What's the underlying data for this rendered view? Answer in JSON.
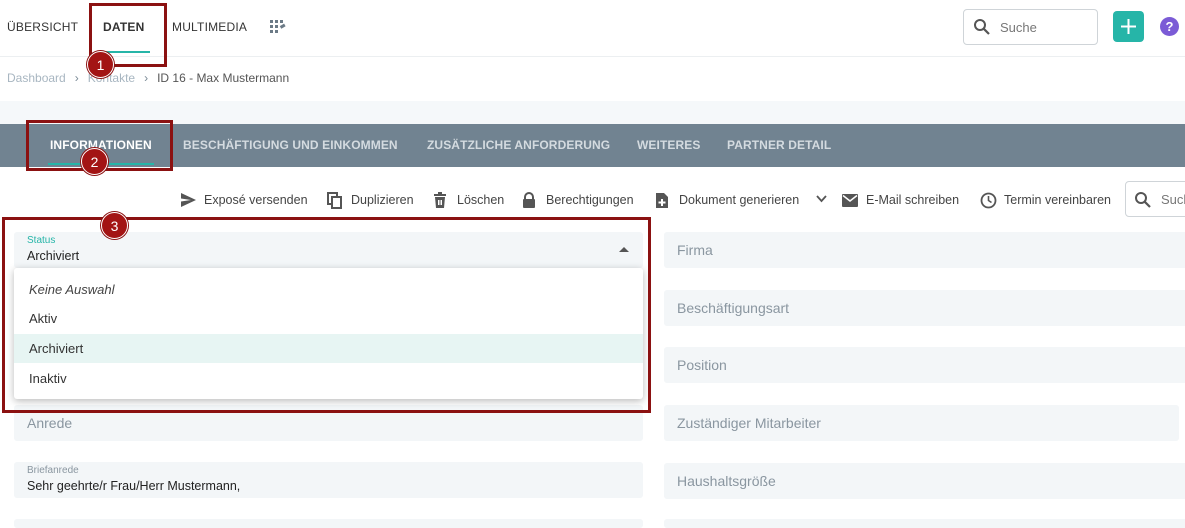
{
  "topnav": {
    "tabs": [
      {
        "label": "ÜBERSICHT"
      },
      {
        "label": "DATEN"
      },
      {
        "label": "MULTIMEDIA"
      }
    ],
    "search_placeholder": "Suche",
    "help_label": "?"
  },
  "breadcrumb": {
    "items": [
      "Dashboard",
      "Kontakte",
      "ID 16 - Max Mustermann"
    ],
    "separator": "›"
  },
  "section_tabs": [
    {
      "label": "INFORMATIONEN"
    },
    {
      "label": "BESCHÄFTIGUNG UND EINKOMMEN"
    },
    {
      "label": "ZUSÄTZLICHE ANFORDERUNG"
    },
    {
      "label": "WEITERES"
    },
    {
      "label": "PARTNER DETAIL"
    }
  ],
  "toolbar": {
    "actions": [
      {
        "label": "Exposé versenden",
        "icon": "send-icon"
      },
      {
        "label": "Duplizieren",
        "icon": "copy-icon"
      },
      {
        "label": "Löschen",
        "icon": "trash-icon"
      },
      {
        "label": "Berechtigungen",
        "icon": "lock-icon"
      },
      {
        "label": "Dokument generieren",
        "icon": "document-plus-icon"
      },
      {
        "label": "E-Mail schreiben",
        "icon": "mail-icon"
      },
      {
        "label": "Termin vereinbaren",
        "icon": "clock-icon"
      }
    ],
    "search_placeholder": "Such"
  },
  "form": {
    "status": {
      "label": "Status",
      "value": "Archiviert"
    },
    "anrede": {
      "label": "Anrede"
    },
    "briefanrede": {
      "label": "Briefanrede",
      "value": "Sehr geehrte/r Frau/Herr Mustermann,"
    },
    "right_fields": [
      "Firma",
      "Beschäftigungsart",
      "Position",
      "Zuständiger Mitarbeiter",
      "Haushaltsgröße"
    ]
  },
  "dropdown": {
    "options": [
      "Keine Auswahl",
      "Aktiv",
      "Archiviert",
      "Inaktiv"
    ],
    "selected": "Archiviert"
  },
  "annotations": {
    "badges": [
      "1",
      "2",
      "3"
    ]
  },
  "colors": {
    "accent": "#26b5a8",
    "tabbar": "#718391",
    "annotation": "#8b1111",
    "help": "#7b5bd6"
  }
}
